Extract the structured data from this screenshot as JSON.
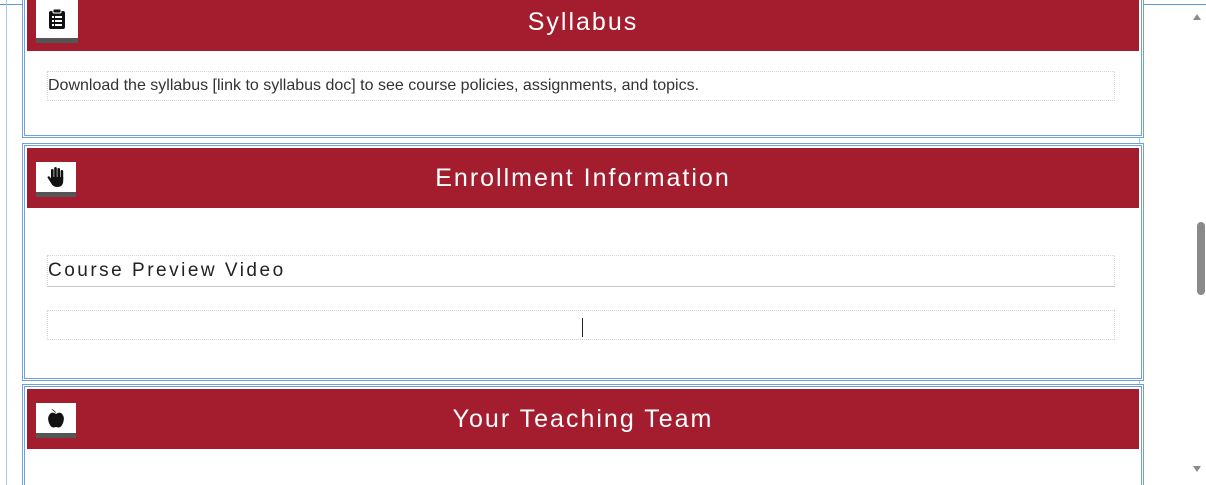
{
  "sections": [
    {
      "title": "Syllabus",
      "icon": "clipboard-list-icon",
      "body": "Download the syllabus [link to syllabus doc] to see course policies, assignments, and topics."
    },
    {
      "title": "Enrollment Information",
      "icon": "hand-icon",
      "subheading": "Course Preview Video",
      "video_placeholder": ""
    },
    {
      "title": "Your Teaching Team",
      "icon": "apple-icon"
    }
  ],
  "colors": {
    "header_bg": "#a31d2f",
    "section_border": "#6fa2d8",
    "header_text": "#ffffff"
  }
}
